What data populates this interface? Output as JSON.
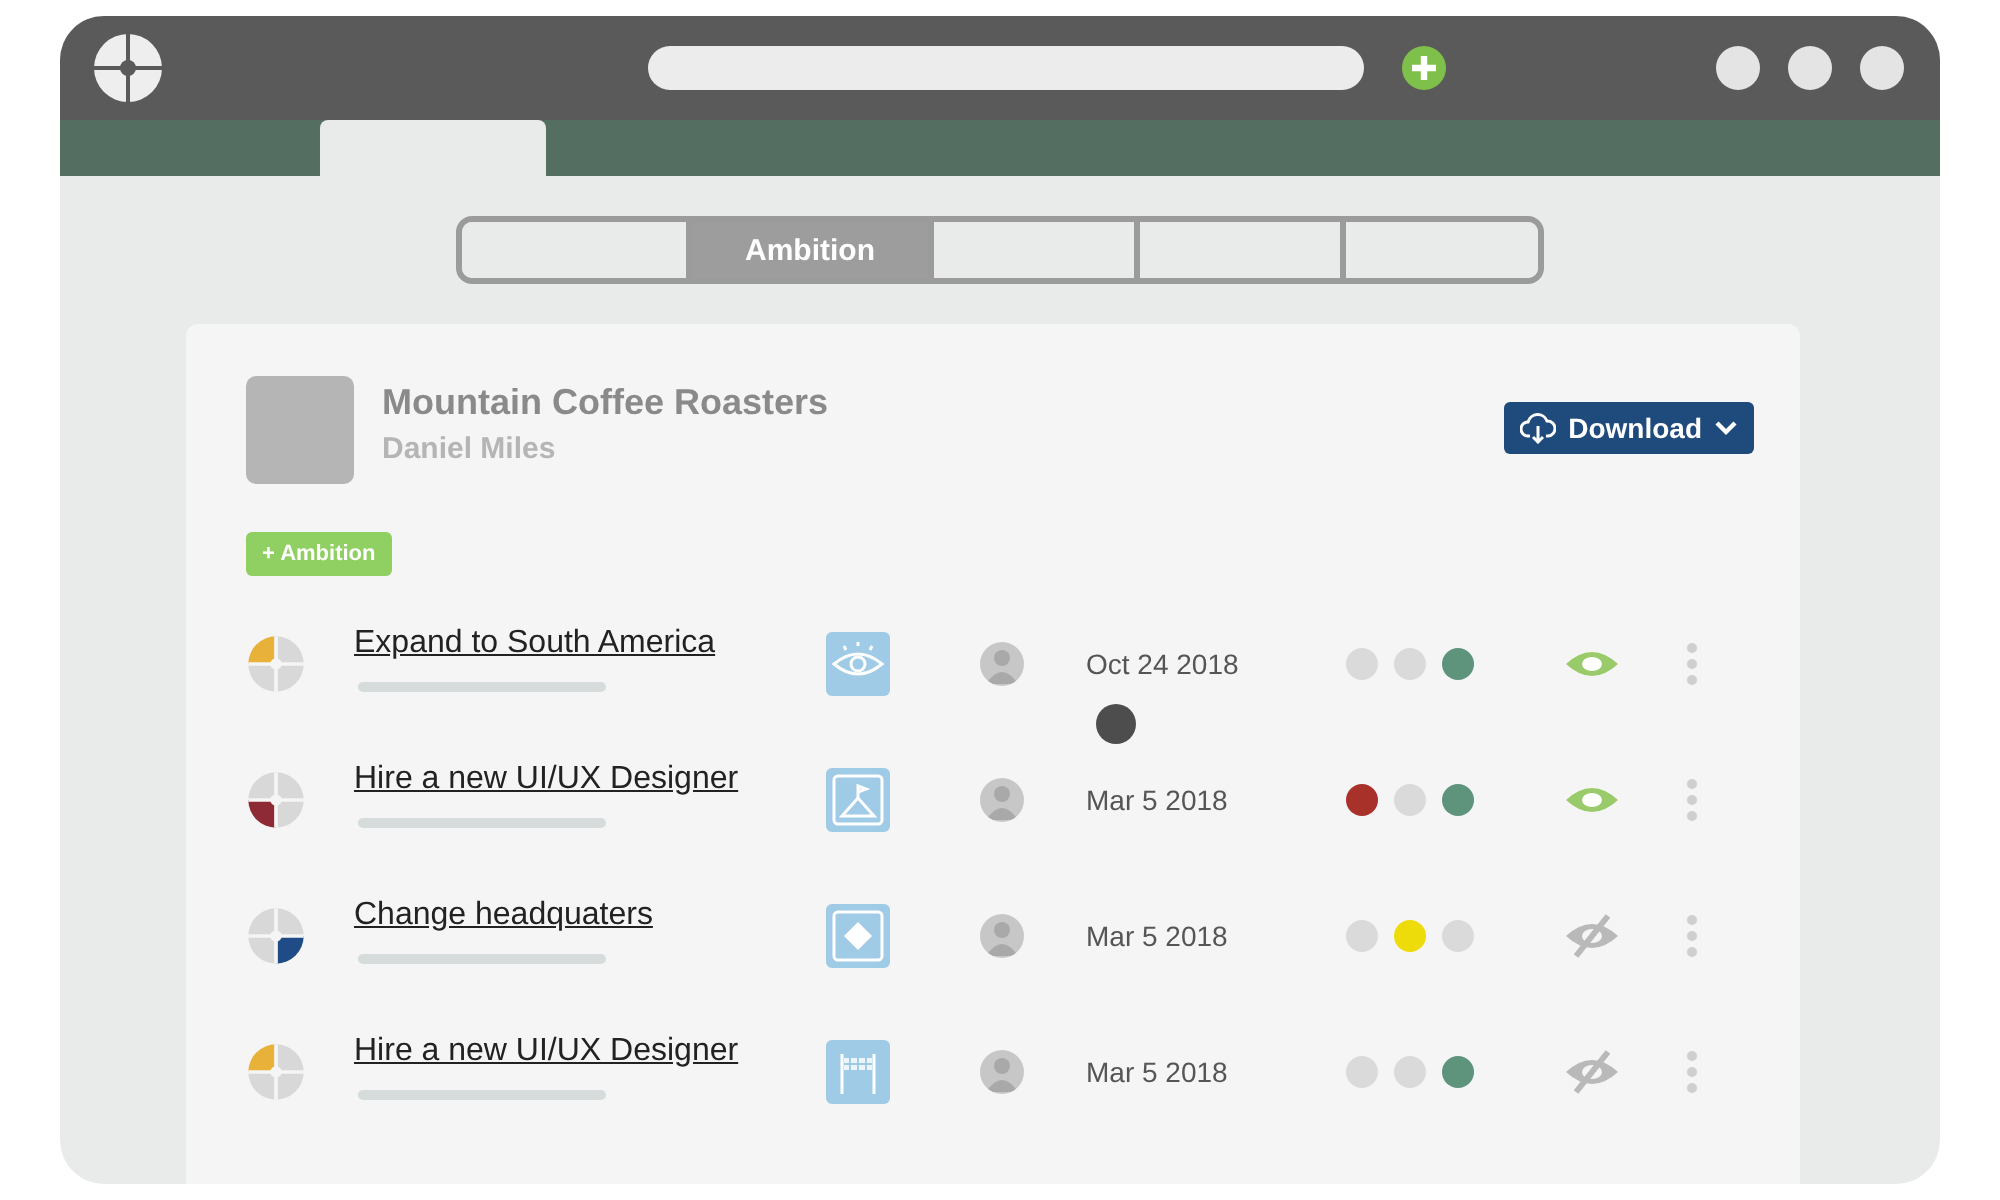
{
  "tabs": [
    {
      "selected": false
    },
    {
      "label": "Ambition",
      "selected": true
    },
    {
      "selected": false
    },
    {
      "selected": false
    },
    {
      "selected": false
    }
  ],
  "company": {
    "name": "Mountain Coffee Roasters",
    "owner": "Daniel Miles"
  },
  "download_button": {
    "label": "Download"
  },
  "add_button": {
    "label": "+ Ambition"
  },
  "goals": [
    {
      "title": "Expand to South America",
      "quarters": [
        {
          "color": "#e8b23a"
        },
        {
          "color": "#d8d8d8"
        },
        {
          "color": "#d8d8d8"
        },
        {
          "color": "#d8d8d8"
        }
      ],
      "kind": "eye",
      "date": "Oct 24 2018",
      "status": [
        {
          "color": "#dadada"
        },
        {
          "color": "#dadada"
        },
        {
          "color": "#5e947c"
        }
      ],
      "visible": true
    },
    {
      "title": "Hire a new UI/UX Designer",
      "quarters": [
        {
          "color": "#d8d8d8"
        },
        {
          "color": "#d8d8d8"
        },
        {
          "color": "#d8d8d8"
        },
        {
          "color": "#8e2a36"
        }
      ],
      "kind": "mountain",
      "date": "Mar 5 2018",
      "status": [
        {
          "color": "#a8322a"
        },
        {
          "color": "#dadada"
        },
        {
          "color": "#5e947c"
        }
      ],
      "visible": true
    },
    {
      "title": "Change headquaters",
      "quarters": [
        {
          "color": "#d8d8d8"
        },
        {
          "color": "#d8d8d8"
        },
        {
          "color": "#1f4c86"
        },
        {
          "color": "#d8d8d8"
        }
      ],
      "kind": "diamond",
      "date": "Mar 5 2018",
      "status": [
        {
          "color": "#dadada"
        },
        {
          "color": "#eedc0a"
        },
        {
          "color": "#dadada"
        }
      ],
      "visible": false
    },
    {
      "title": "Hire a new UI/UX Designer",
      "quarters": [
        {
          "color": "#e8b23a"
        },
        {
          "color": "#d8d8d8"
        },
        {
          "color": "#d8d8d8"
        },
        {
          "color": "#d8d8d8"
        }
      ],
      "kind": "finish",
      "date": "Mar 5 2018",
      "status": [
        {
          "color": "#dadada"
        },
        {
          "color": "#dadada"
        },
        {
          "color": "#5e947c"
        }
      ],
      "visible": false
    }
  ]
}
